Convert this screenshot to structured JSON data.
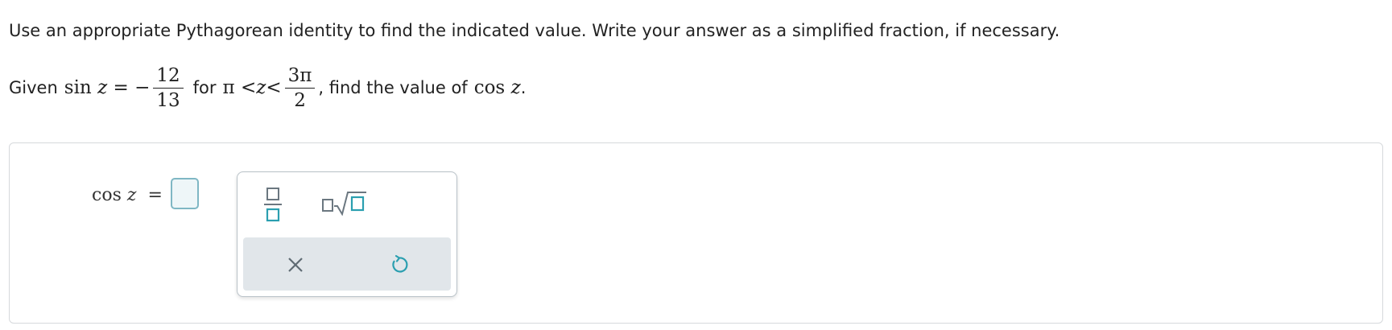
{
  "instructions": "Use an appropriate Pythagorean identity to find the indicated value. Write your answer as a simplified fraction, if necessary.",
  "given": {
    "prefix": "Given",
    "sin_func": "sin",
    "variable": "z",
    "equals_neg": "= −",
    "sin_num": "12",
    "sin_den": "13",
    "for_text": "for",
    "pi": "π",
    "lt1": "<",
    "lt2": "<",
    "upper_num": "3π",
    "upper_den": "2",
    "comma_find": ", find the value of",
    "cos_func": "cos",
    "period": "."
  },
  "answer": {
    "label_func": "cos",
    "label_var": "z",
    "equals": "=",
    "value": ""
  },
  "palette": {
    "tools": [
      "fraction-template",
      "nth-root-template"
    ],
    "actions": [
      "clear",
      "undo"
    ]
  },
  "colors": {
    "accent": "#2b9fb0",
    "answer_box_border": "#7fb7c4",
    "action_bar_bg": "#e1e6ea",
    "icon_gray": "#6b7780"
  }
}
